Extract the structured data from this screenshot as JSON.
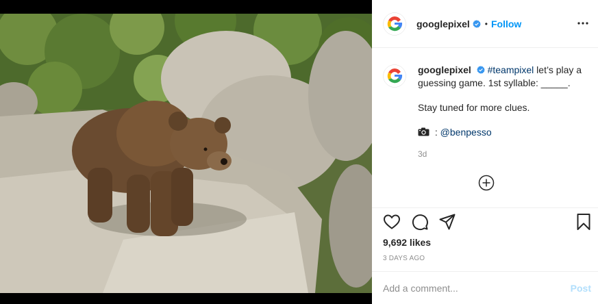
{
  "post": {
    "image_alt": "",
    "author": "googlepixel",
    "follow_label": "Follow",
    "separator": "•",
    "caption": {
      "username": "googlepixel",
      "hashtag": "#teampixel",
      "text": " let’s play a guessing game. 1st syllable: _____.",
      "line2": "Stay tuned for more clues.",
      "credit_prefix": " : ",
      "credit_handle": "@benpesso",
      "time_ago": "3d"
    },
    "likes": "9,692 likes",
    "date": "3 DAYS AGO",
    "comment": {
      "placeholder": "Add a comment...",
      "post_label": "Post"
    }
  },
  "colors": {
    "accent": "#0095f6",
    "verified": "#3897f0",
    "link": "#00376b",
    "post_disabled": "#b2dffc",
    "muted": "#8e8e8e"
  },
  "icons": {
    "verified": "verified-badge-icon",
    "more": "more-options-icon",
    "like": "heart-icon",
    "comment": "comment-icon",
    "share": "paper-plane-icon",
    "save": "bookmark-icon",
    "load_more": "plus-circle-icon",
    "camera": "camera-icon"
  }
}
